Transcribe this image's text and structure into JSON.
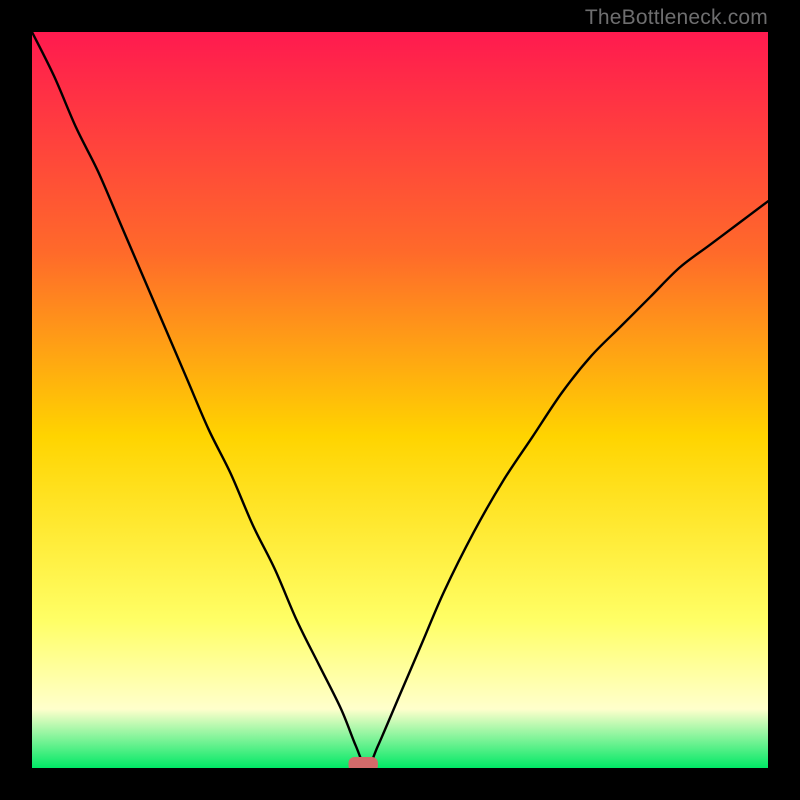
{
  "attribution": "TheBottleneck.com",
  "chart_data": {
    "type": "line",
    "title": "",
    "xlabel": "",
    "ylabel": "",
    "xlim": [
      0,
      100
    ],
    "ylim": [
      0,
      100
    ],
    "series": [
      {
        "name": "bottleneck-curve",
        "x": [
          0,
          3,
          6,
          9,
          12,
          15,
          18,
          21,
          24,
          27,
          30,
          33,
          36,
          39,
          42,
          44,
          45.5,
          47,
          50,
          53,
          56,
          60,
          64,
          68,
          72,
          76,
          80,
          84,
          88,
          92,
          96,
          100
        ],
        "values": [
          100,
          94,
          87,
          81,
          74,
          67,
          60,
          53,
          46,
          40,
          33,
          27,
          20,
          14,
          8,
          3,
          0,
          3,
          10,
          17,
          24,
          32,
          39,
          45,
          51,
          56,
          60,
          64,
          68,
          71,
          74,
          77
        ]
      }
    ],
    "gradient_colors": {
      "top": "#ff1a4f",
      "upper": "#ff6a2a",
      "middle": "#ffd400",
      "lower": "#ffff66",
      "cream": "#ffffcc",
      "bottom": "#00e865"
    },
    "marker": {
      "x": 45.0,
      "y": 0.5,
      "color": "#d36a6a",
      "width": 4.0,
      "height": 2.0
    }
  }
}
